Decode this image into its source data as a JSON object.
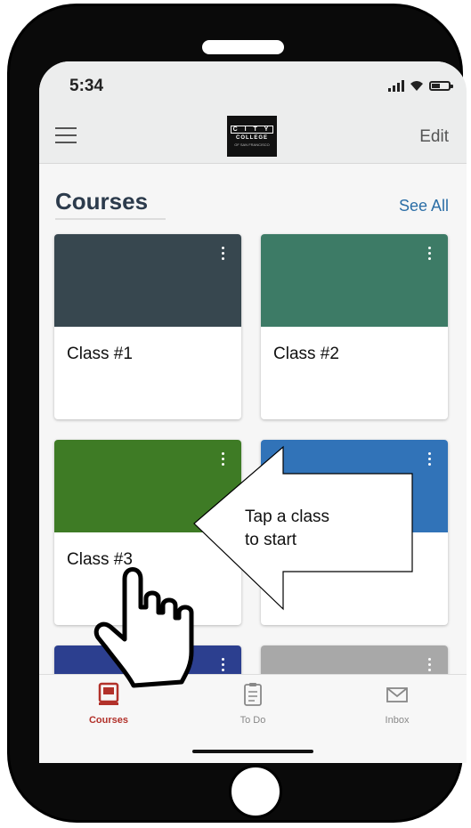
{
  "status_bar": {
    "time": "5:34"
  },
  "nav": {
    "logo_line1": "C I T Y",
    "logo_line2": "COLLEGE",
    "logo_line3": "OF SAN FRANCISCO",
    "edit_label": "Edit"
  },
  "courses_section": {
    "title": "Courses",
    "see_all": "See All"
  },
  "courses": [
    {
      "title": "Class #1",
      "color": "#37474f"
    },
    {
      "title": "Class #2",
      "color": "#3d7b66"
    },
    {
      "title": "Class #3",
      "color": "#3e7b25"
    },
    {
      "title": "",
      "color": "#3173b8"
    },
    {
      "title": "",
      "color": "#2c3f8f"
    },
    {
      "title": "",
      "color": "#a8a8a8"
    }
  ],
  "tabs": [
    {
      "label": "Courses",
      "icon": "courses-icon",
      "active": true
    },
    {
      "label": "To Do",
      "icon": "todo-icon",
      "active": false
    },
    {
      "label": "Inbox",
      "icon": "inbox-icon",
      "active": false
    }
  ],
  "callout": {
    "line1": "Tap a class",
    "line2": "to start"
  },
  "colors": {
    "accent": "#b2312a",
    "link": "#2b6ea6",
    "title": "#2c3b4c"
  }
}
